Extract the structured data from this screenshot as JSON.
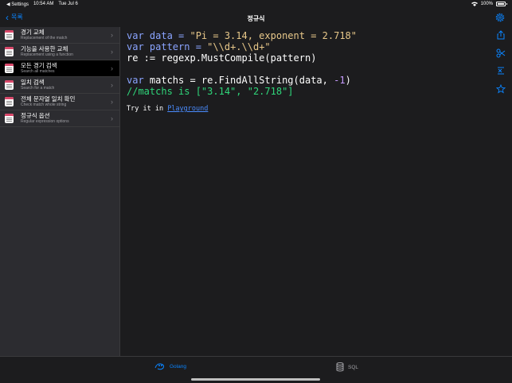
{
  "status_bar": {
    "back_app": "◀ Settings",
    "time": "10:54 AM",
    "date": "Tue Jul 6",
    "battery": "100%"
  },
  "nav": {
    "back_label": "목록",
    "title": "정규식"
  },
  "sidebar": {
    "items": [
      {
        "title": "경기 교체",
        "subtitle": "Replacement of the match"
      },
      {
        "title": "기능을 사용한 교체",
        "subtitle": "Replacement using a function"
      },
      {
        "title": "모든 경기 검색",
        "subtitle": "Search all matches",
        "active": true
      },
      {
        "title": "일치 검색",
        "subtitle": "Search for a match"
      },
      {
        "title": "전체 문자열 일치 확인",
        "subtitle": "Check match whole string"
      },
      {
        "title": "정규식 옵션",
        "subtitle": "Regular expression options"
      }
    ]
  },
  "code": {
    "line1": {
      "kw": "var",
      "name": " data = ",
      "str": "\"Pi = 3.14, exponent = 2.718\""
    },
    "line2": {
      "kw": "var",
      "name": " pattern = ",
      "str_a": "\"\\\\d+.\\\\d+\""
    },
    "line3": "re := regexp.MustCompile(pattern)",
    "line4": {
      "kw": "var",
      "name": " matchs = re.FindAllString(data, ",
      "num": "-1",
      "end": ")"
    },
    "line5": "//matchs is [\"3.14\", \"2.718\"]"
  },
  "try": {
    "prefix": "Try it in ",
    "link": "Playground"
  },
  "tabs": {
    "golang": "Golang",
    "sql": "SQL"
  },
  "colors": {
    "accent": "#0a84ff",
    "keyword": "#8aa4ff",
    "string": "#e8c88a",
    "comment": "#2fd67a"
  }
}
